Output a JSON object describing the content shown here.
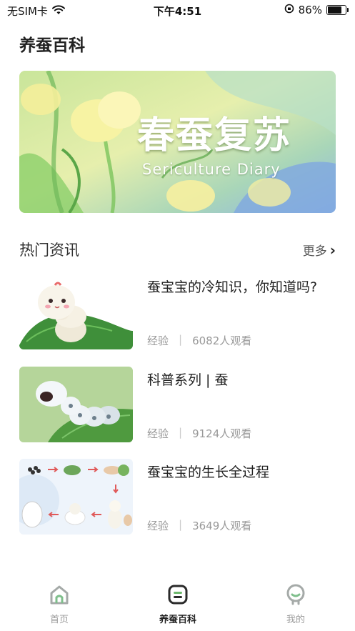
{
  "status_bar": {
    "carrier": "无SIM卡",
    "time": "下午4:51",
    "battery": "86%",
    "battery_level": 0.86
  },
  "page": {
    "title": "养蚕百科"
  },
  "banner": {
    "title": "春蚕复苏",
    "subtitle": "Sericulture Diary"
  },
  "section": {
    "title": "热门资讯",
    "more_label": "更多"
  },
  "news": [
    {
      "title": "蚕宝宝的冷知识，你知道吗?",
      "category": "经验",
      "views": "6082人观看"
    },
    {
      "title": "科普系列 | 蚕",
      "category": "经验",
      "views": "9124人观看"
    },
    {
      "title": "蚕宝宝的生长全过程",
      "category": "经验",
      "views": "3649人观看"
    }
  ],
  "tabs": [
    {
      "label": "首页",
      "icon": "home-icon",
      "active": false
    },
    {
      "label": "养蚕百科",
      "icon": "encyclopedia-icon",
      "active": true
    },
    {
      "label": "我的",
      "icon": "profile-icon",
      "active": false
    }
  ],
  "colors": {
    "accent_green": "#6bb86b",
    "tab_active": "#222222",
    "tab_inactive": "#999999"
  }
}
